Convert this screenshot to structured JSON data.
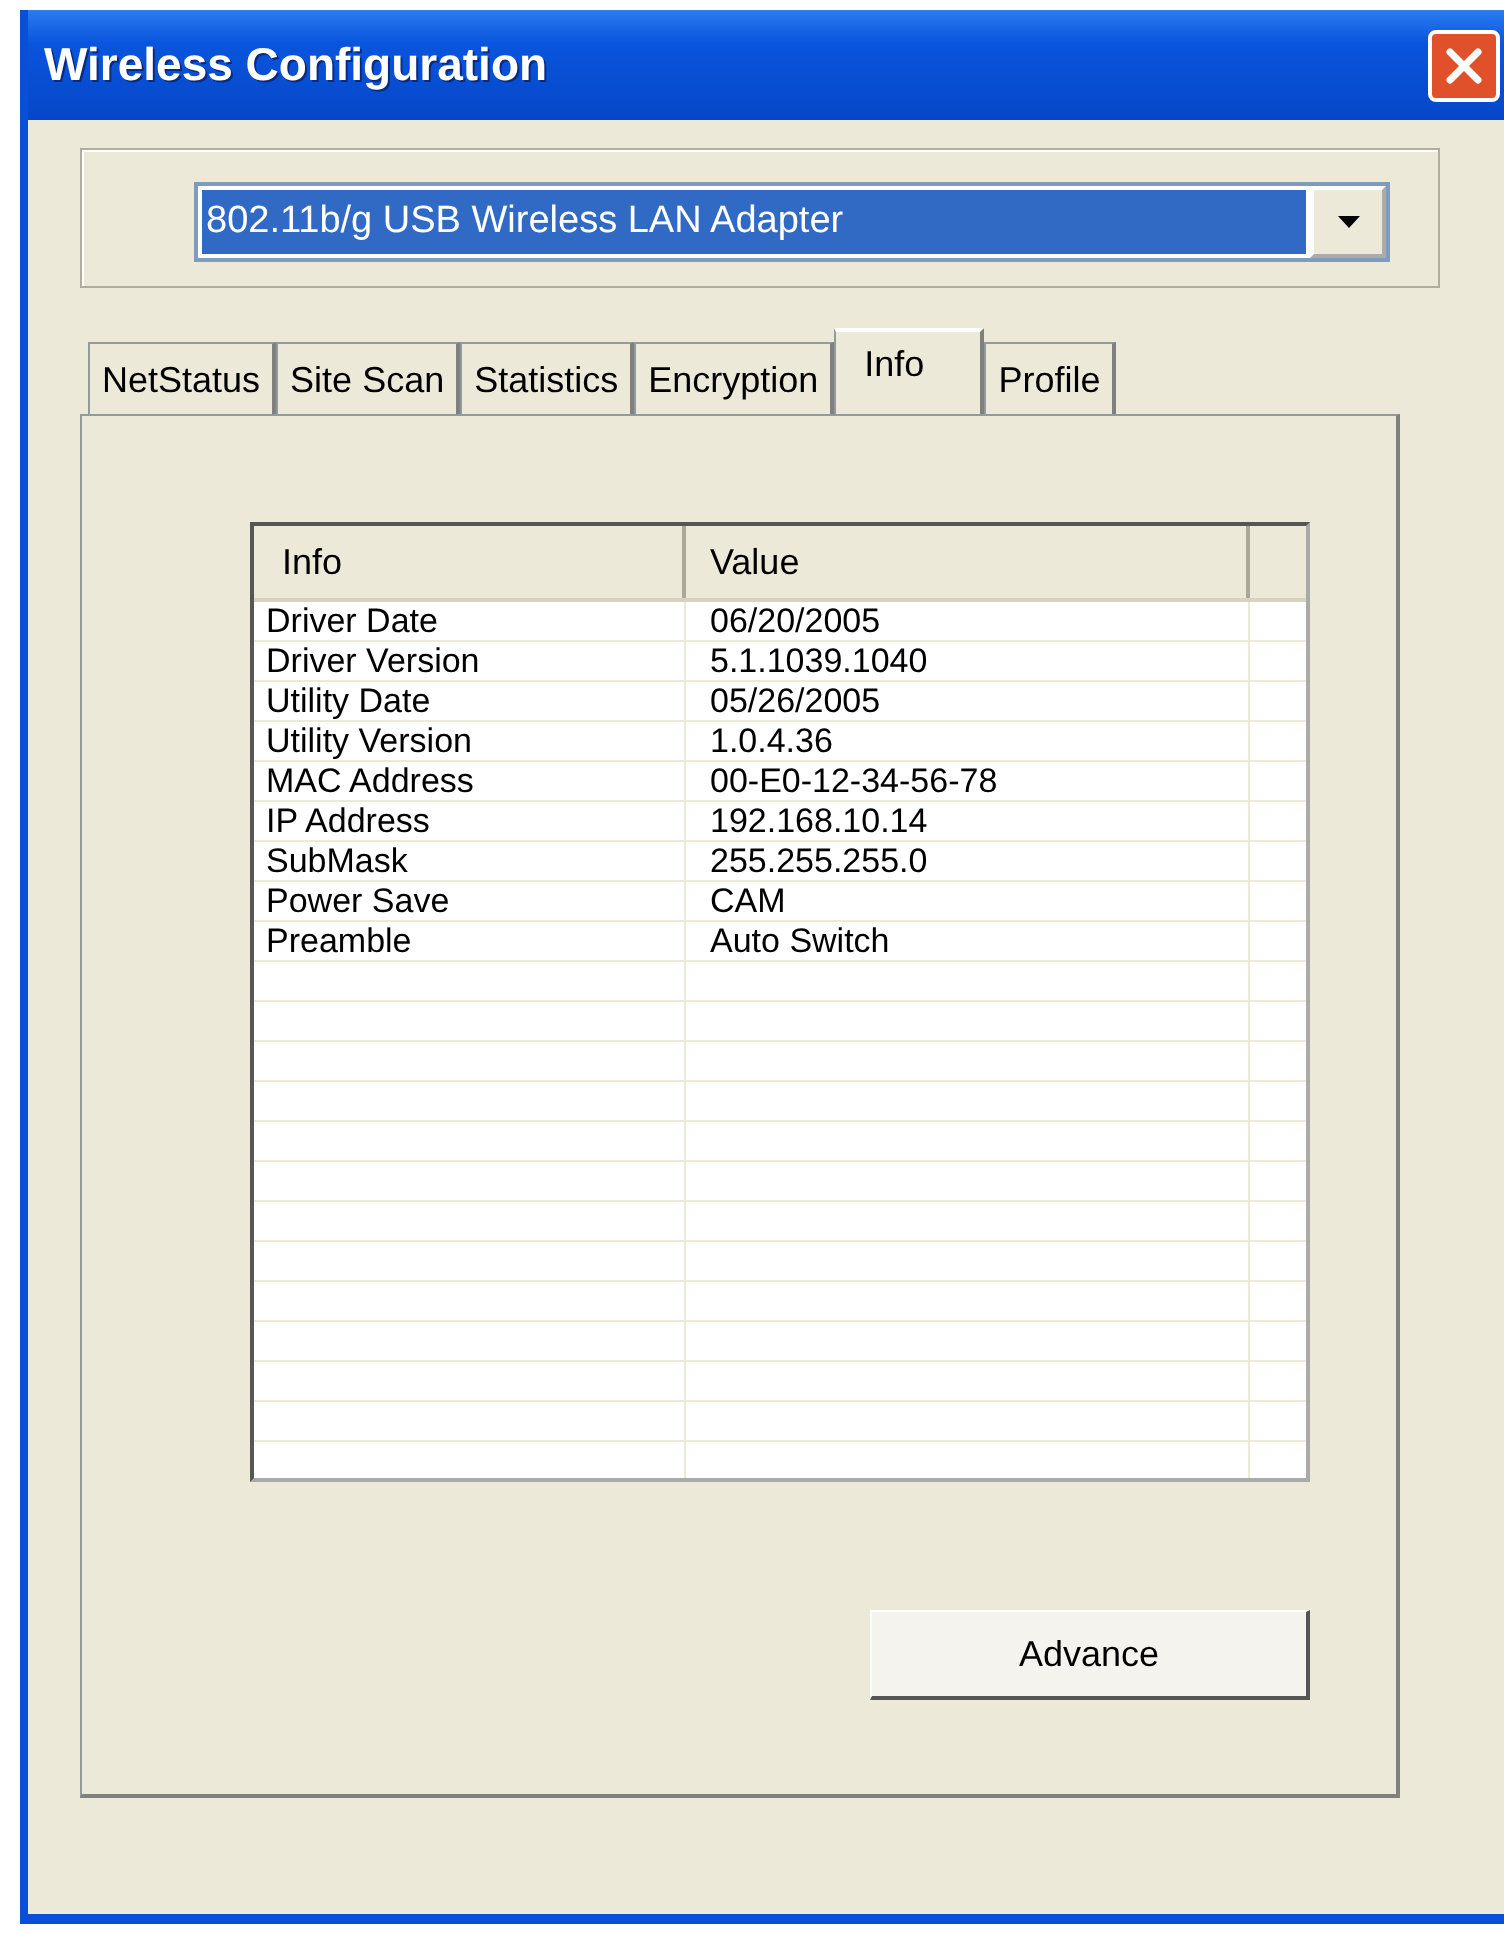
{
  "window": {
    "title": "Wireless Configuration"
  },
  "adapter": {
    "value": "802.11b/g USB Wireless LAN Adapter"
  },
  "tabs": [
    {
      "label": "NetStatus",
      "selected": false
    },
    {
      "label": "Site Scan",
      "selected": false
    },
    {
      "label": "Statistics",
      "selected": false
    },
    {
      "label": "Encryption",
      "selected": false
    },
    {
      "label": "Info",
      "selected": true
    },
    {
      "label": "Profile",
      "selected": false
    }
  ],
  "table": {
    "columns": [
      "Info",
      "Value"
    ],
    "rows": [
      [
        "Driver Date",
        "06/20/2005"
      ],
      [
        "Driver Version",
        "5.1.1039.1040"
      ],
      [
        "Utility Date",
        "05/26/2005"
      ],
      [
        "Utility Version",
        "1.0.4.36"
      ],
      [
        "MAC Address",
        "00-E0-12-34-56-78"
      ],
      [
        "IP Address",
        "192.168.10.14"
      ],
      [
        "SubMask",
        "255.255.255.0"
      ],
      [
        "Power Save",
        "CAM"
      ],
      [
        "Preamble",
        "Auto Switch"
      ]
    ]
  },
  "buttons": [
    "Advance"
  ]
}
